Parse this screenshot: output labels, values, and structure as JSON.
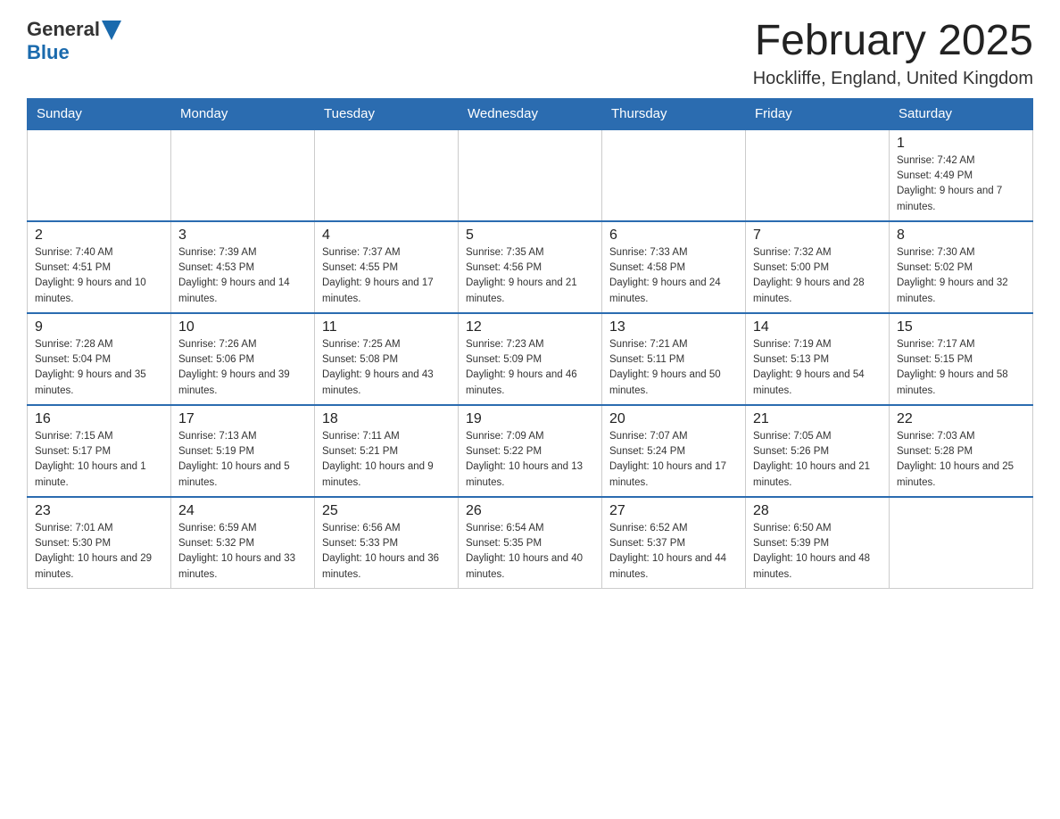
{
  "header": {
    "logo": {
      "general": "General",
      "blue": "Blue"
    },
    "title": "February 2025",
    "location": "Hockliffe, England, United Kingdom"
  },
  "weekdays": [
    "Sunday",
    "Monday",
    "Tuesday",
    "Wednesday",
    "Thursday",
    "Friday",
    "Saturday"
  ],
  "weeks": [
    [
      {
        "day": "",
        "info": ""
      },
      {
        "day": "",
        "info": ""
      },
      {
        "day": "",
        "info": ""
      },
      {
        "day": "",
        "info": ""
      },
      {
        "day": "",
        "info": ""
      },
      {
        "day": "",
        "info": ""
      },
      {
        "day": "1",
        "info": "Sunrise: 7:42 AM\nSunset: 4:49 PM\nDaylight: 9 hours and 7 minutes."
      }
    ],
    [
      {
        "day": "2",
        "info": "Sunrise: 7:40 AM\nSunset: 4:51 PM\nDaylight: 9 hours and 10 minutes."
      },
      {
        "day": "3",
        "info": "Sunrise: 7:39 AM\nSunset: 4:53 PM\nDaylight: 9 hours and 14 minutes."
      },
      {
        "day": "4",
        "info": "Sunrise: 7:37 AM\nSunset: 4:55 PM\nDaylight: 9 hours and 17 minutes."
      },
      {
        "day": "5",
        "info": "Sunrise: 7:35 AM\nSunset: 4:56 PM\nDaylight: 9 hours and 21 minutes."
      },
      {
        "day": "6",
        "info": "Sunrise: 7:33 AM\nSunset: 4:58 PM\nDaylight: 9 hours and 24 minutes."
      },
      {
        "day": "7",
        "info": "Sunrise: 7:32 AM\nSunset: 5:00 PM\nDaylight: 9 hours and 28 minutes."
      },
      {
        "day": "8",
        "info": "Sunrise: 7:30 AM\nSunset: 5:02 PM\nDaylight: 9 hours and 32 minutes."
      }
    ],
    [
      {
        "day": "9",
        "info": "Sunrise: 7:28 AM\nSunset: 5:04 PM\nDaylight: 9 hours and 35 minutes."
      },
      {
        "day": "10",
        "info": "Sunrise: 7:26 AM\nSunset: 5:06 PM\nDaylight: 9 hours and 39 minutes."
      },
      {
        "day": "11",
        "info": "Sunrise: 7:25 AM\nSunset: 5:08 PM\nDaylight: 9 hours and 43 minutes."
      },
      {
        "day": "12",
        "info": "Sunrise: 7:23 AM\nSunset: 5:09 PM\nDaylight: 9 hours and 46 minutes."
      },
      {
        "day": "13",
        "info": "Sunrise: 7:21 AM\nSunset: 5:11 PM\nDaylight: 9 hours and 50 minutes."
      },
      {
        "day": "14",
        "info": "Sunrise: 7:19 AM\nSunset: 5:13 PM\nDaylight: 9 hours and 54 minutes."
      },
      {
        "day": "15",
        "info": "Sunrise: 7:17 AM\nSunset: 5:15 PM\nDaylight: 9 hours and 58 minutes."
      }
    ],
    [
      {
        "day": "16",
        "info": "Sunrise: 7:15 AM\nSunset: 5:17 PM\nDaylight: 10 hours and 1 minute."
      },
      {
        "day": "17",
        "info": "Sunrise: 7:13 AM\nSunset: 5:19 PM\nDaylight: 10 hours and 5 minutes."
      },
      {
        "day": "18",
        "info": "Sunrise: 7:11 AM\nSunset: 5:21 PM\nDaylight: 10 hours and 9 minutes."
      },
      {
        "day": "19",
        "info": "Sunrise: 7:09 AM\nSunset: 5:22 PM\nDaylight: 10 hours and 13 minutes."
      },
      {
        "day": "20",
        "info": "Sunrise: 7:07 AM\nSunset: 5:24 PM\nDaylight: 10 hours and 17 minutes."
      },
      {
        "day": "21",
        "info": "Sunrise: 7:05 AM\nSunset: 5:26 PM\nDaylight: 10 hours and 21 minutes."
      },
      {
        "day": "22",
        "info": "Sunrise: 7:03 AM\nSunset: 5:28 PM\nDaylight: 10 hours and 25 minutes."
      }
    ],
    [
      {
        "day": "23",
        "info": "Sunrise: 7:01 AM\nSunset: 5:30 PM\nDaylight: 10 hours and 29 minutes."
      },
      {
        "day": "24",
        "info": "Sunrise: 6:59 AM\nSunset: 5:32 PM\nDaylight: 10 hours and 33 minutes."
      },
      {
        "day": "25",
        "info": "Sunrise: 6:56 AM\nSunset: 5:33 PM\nDaylight: 10 hours and 36 minutes."
      },
      {
        "day": "26",
        "info": "Sunrise: 6:54 AM\nSunset: 5:35 PM\nDaylight: 10 hours and 40 minutes."
      },
      {
        "day": "27",
        "info": "Sunrise: 6:52 AM\nSunset: 5:37 PM\nDaylight: 10 hours and 44 minutes."
      },
      {
        "day": "28",
        "info": "Sunrise: 6:50 AM\nSunset: 5:39 PM\nDaylight: 10 hours and 48 minutes."
      },
      {
        "day": "",
        "info": ""
      }
    ]
  ]
}
